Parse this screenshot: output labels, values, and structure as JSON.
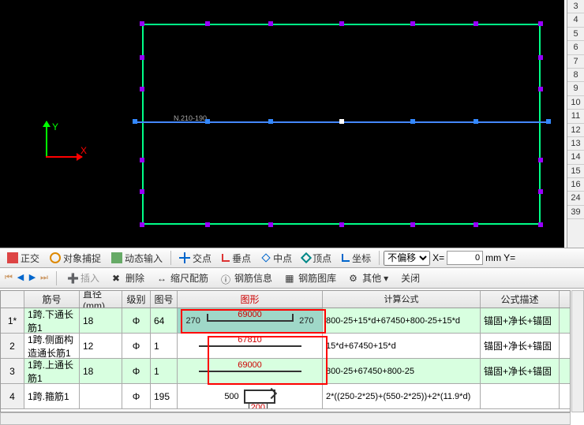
{
  "canvas": {
    "label_y": "Y",
    "label_x": "X",
    "dim_text": "N.210-190"
  },
  "ruler": [
    "3",
    "4",
    "5",
    "6",
    "7",
    "8",
    "9",
    "10",
    "11",
    "12",
    "13",
    "14",
    "15",
    "16",
    "24",
    "39"
  ],
  "toolbar1": {
    "ortho": "正交",
    "snap": "对象捕捉",
    "dyn": "动态输入",
    "cross": "交点",
    "perp": "垂点",
    "mid": "中点",
    "vertex": "顶点",
    "coord": "坐标",
    "offset": "不偏移",
    "x_label": "X=",
    "x_value": "0",
    "mm": "mm",
    "y_label": "Y="
  },
  "toolbar2": {
    "insert": "插入",
    "delete": "删除",
    "scale": "缩尺配筋",
    "info": "钢筋信息",
    "lib": "钢筋图库",
    "other": "其他",
    "close": "关闭"
  },
  "grid": {
    "headers": {
      "num": "",
      "name": "筋号",
      "dia": "直径(mm)",
      "grade": "级别",
      "figno": "图号",
      "shape": "图形",
      "formula": "计算公式",
      "desc": "公式描述"
    },
    "rows": [
      {
        "num": "1*",
        "name": "1跨.下通长筋1",
        "dia": "18",
        "grade": "Φ",
        "figno": "64",
        "shape": {
          "left": "270",
          "mid": "69000",
          "right": "270",
          "type": "hook"
        },
        "formula": "800-25+15*d+67450+800-25+15*d",
        "desc": "锚固+净长+锚固"
      },
      {
        "num": "2",
        "name": "1跨.侧面构造通长筋1",
        "dia": "12",
        "grade": "Φ",
        "figno": "1",
        "shape": {
          "mid": "67810",
          "type": "plain"
        },
        "formula": "15*d+67450+15*d",
        "desc": "锚固+净长+锚固"
      },
      {
        "num": "3",
        "name": "1跨.上通长筋1",
        "dia": "18",
        "grade": "Φ",
        "figno": "1",
        "shape": {
          "mid": "69000",
          "type": "plain"
        },
        "formula": "800-25+67450+800-25",
        "desc": "锚固+净长+锚固"
      },
      {
        "num": "4",
        "name": "1跨.箍筋1",
        "dia": "",
        "grade": "Φ",
        "figno": "195",
        "shape": {
          "left": "500",
          "mid": "200",
          "type": "stirrup"
        },
        "formula": "2*((250-2*25)+(550-2*25))+2*(11.9*d)",
        "desc": ""
      }
    ]
  }
}
